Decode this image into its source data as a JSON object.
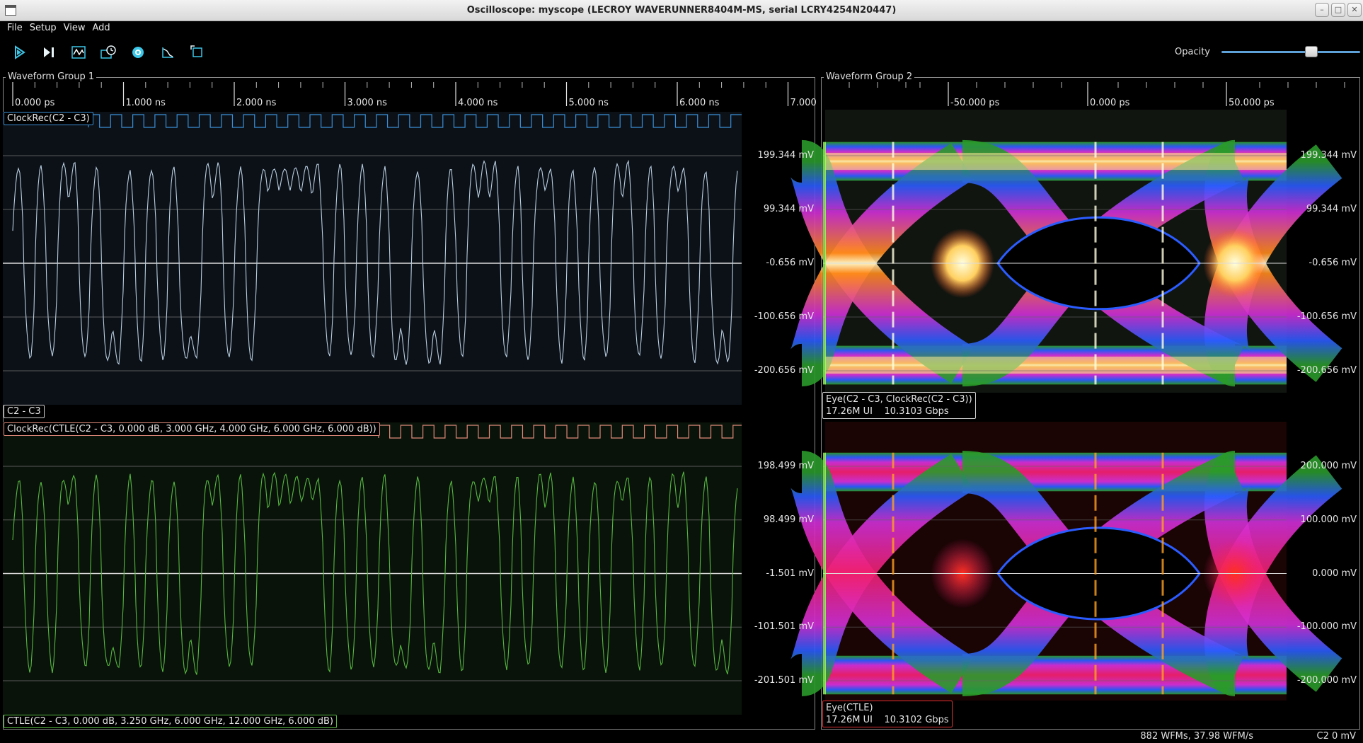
{
  "window": {
    "title": "Oscilloscope: myscope (LECROY WAVERUNNER8404M-MS, serial LCRY4254N20447)"
  },
  "menu": [
    "File",
    "Setup",
    "View",
    "Add"
  ],
  "toolbar": {
    "buttons": [
      "start-trigger",
      "single-trigger",
      "waveform",
      "history",
      "settings",
      "fft-math",
      "fullscreen"
    ],
    "opacity_label": "Opacity",
    "opacity_value": 0.6
  },
  "group1": {
    "title": "Waveform Group 1",
    "time_ticks": [
      "0.000 ps",
      "1.000 ns",
      "2.000 ns",
      "3.000 ns",
      "4.000 ns",
      "5.000 ns",
      "6.000 ns",
      "7.000"
    ],
    "top_clock_label": "ClockRec(C2 - C3)",
    "top_trace_label": "C2 - C3",
    "top_volt_labels": [
      "199.344 mV",
      "99.344 mV",
      "-0.656 mV",
      "-100.656 mV",
      "-200.656 mV"
    ],
    "bottom_clock_label": "ClockRec(CTLE(C2 - C3, 0.000 dB, 3.000 GHz, 4.000 GHz, 6.000 GHz, 6.000 dB))",
    "bottom_trace_label": "CTLE(C2 - C3, 0.000 dB, 3.250 GHz, 6.000 GHz, 12.000 GHz, 6.000 dB)",
    "bottom_volt_labels": [
      "198.499 mV",
      "98.499 mV",
      "-1.501 mV",
      "-101.501 mV",
      "-201.501 mV"
    ]
  },
  "group2": {
    "title": "Waveform Group 2",
    "time_ticks": [
      "-50.000 ps",
      "0.000 ps",
      "50.000 ps"
    ],
    "top_volt_labels": [
      "199.344 mV",
      "99.344 mV",
      "-0.656 mV",
      "-100.656 mV",
      "-200.656 mV"
    ],
    "top_eye_label_1": "Eye(C2 - C3, ClockRec(C2 - C3))",
    "top_eye_label_2": "17.26M UI    10.3103 Gbps",
    "bottom_volt_labels": [
      "200.000 mV",
      "100.000 mV",
      "0.000 mV",
      "-100.000 mV",
      "-200.000 mV"
    ],
    "bottom_eye_label_1": "Eye(CTLE)",
    "bottom_eye_label_2": "17.26M UI    10.3102 Gbps"
  },
  "status": {
    "text": "882 WFMs, 37.98 WFM/s",
    "channel": "C2 0 mV"
  },
  "colors": {
    "clock_top": "#3a8fd6",
    "trace_top": "#b8cde0",
    "clock_bottom": "#e08a7a",
    "trace_bottom": "#55b840",
    "eye_top_border": "#cccccc",
    "eye_bottom_border": "#e03030"
  }
}
